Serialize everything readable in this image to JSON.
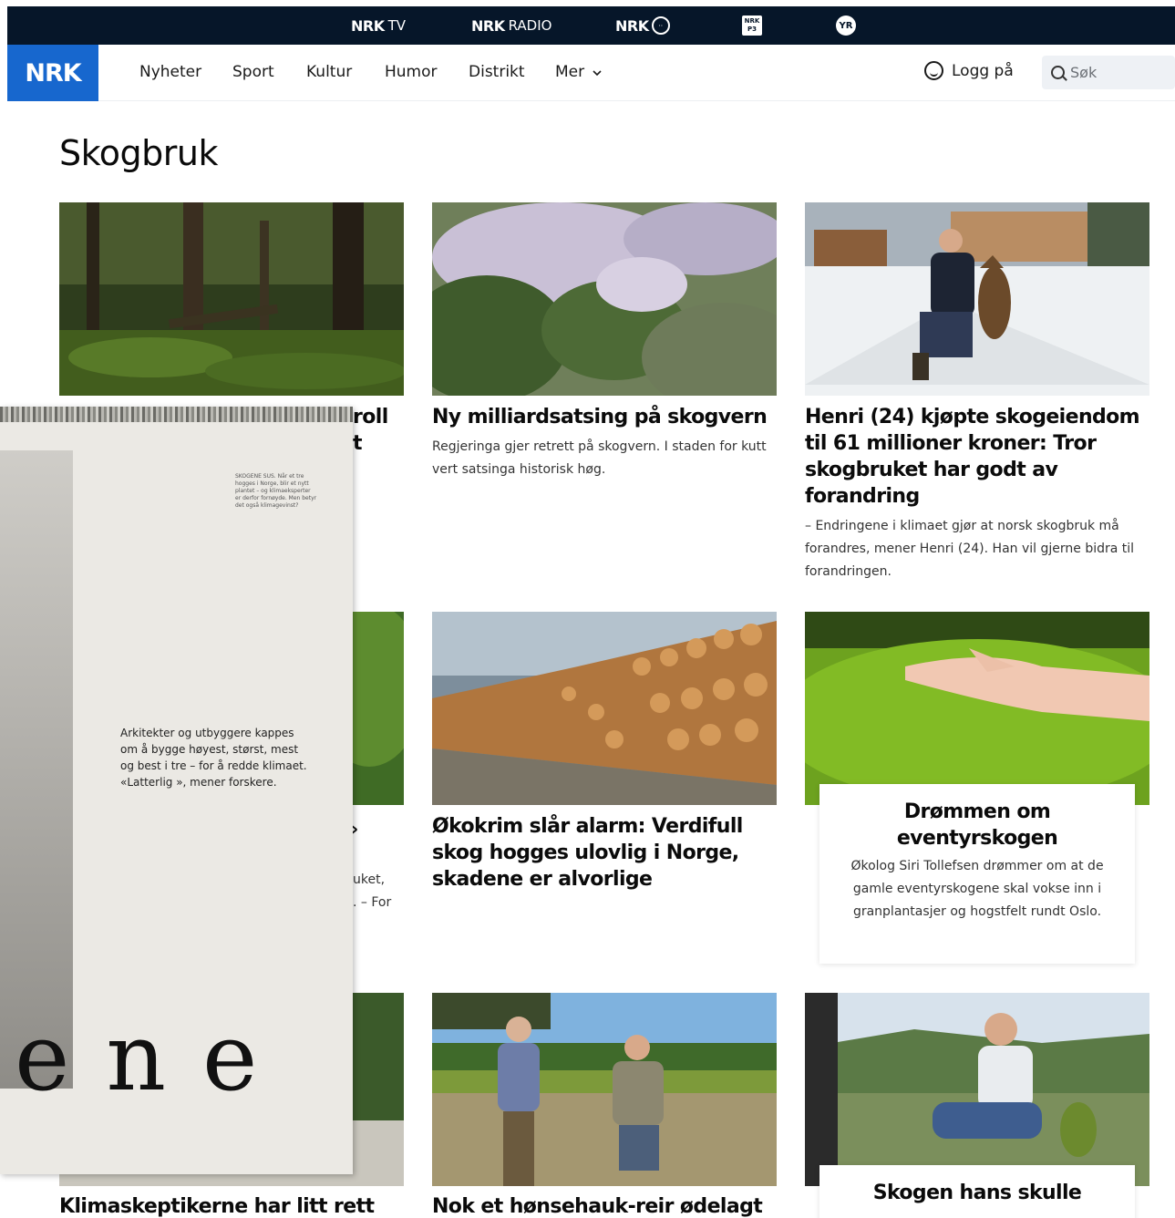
{
  "services": [
    {
      "brand": "NRK",
      "sub": "TV"
    },
    {
      "brand": "NRK",
      "sub": "RADIO"
    },
    {
      "brand": "NRK",
      "sub": ""
    },
    {
      "brand": "NRK P3",
      "sub": ""
    },
    {
      "brand": "YR",
      "sub": ""
    }
  ],
  "nav": {
    "logo": "NRK",
    "items": [
      "Nyheter",
      "Sport",
      "Kultur",
      "Humor",
      "Distrikt",
      "Mer"
    ],
    "login": "Logg på",
    "search_placeholder": "Søk"
  },
  "page_title": "Skogbruk",
  "cards": [
    {
      "title_fragment_1": "roll",
      "title_fragment_2": "t"
    },
    {
      "title": "Ny milliardsatsing på skogvern",
      "text": "Regjeringa gjer retrett på skogvern. I staden for kutt vert satsinga historisk høg."
    },
    {
      "title": "Henri (24) kjøpte skogeiendom til 61 millioner kroner: Tror skogbruket har godt av forandring",
      "text": "– Endringene i klimaet gjør at norsk skogbruk må forandres, mener Henri (24). Han vil gjerne bidra til forandringen."
    },
    {
      "fragment_1": "›",
      "fragment_2": "uket,",
      "fragment_3": ". – For"
    },
    {
      "title": "Økokrim slår alarm: Verdifull skog hogges ulovlig i Norge, skadene er alvorlige"
    },
    {
      "title": "Drømmen om eventyrskogen",
      "text": "Økolog Siri Tollefsen drømmer om at de gamle eventyrskogene skal vokse inn i granplantasjer og hogstfelt rundt Oslo."
    },
    {
      "title": "Klimaskeptikerne har litt rett"
    },
    {
      "title": "Nok et hønsehauk-reir ødelagt av"
    },
    {
      "title": "Skogen hans skulle"
    }
  ],
  "overlay": {
    "small_text": "SKOGENE SUS. Når et tre hogges i Norge, blir et nytt plantet – og klimaeksperter er derfor fornøyde. Men betyr det også klimagevinst?",
    "quote": "Arkitekter og utbyggere kappes om å bygge høyest, størst, mest og best i tre – for å redde klimaet. «Latterlig », mener forskere.",
    "big_word": "ene"
  }
}
